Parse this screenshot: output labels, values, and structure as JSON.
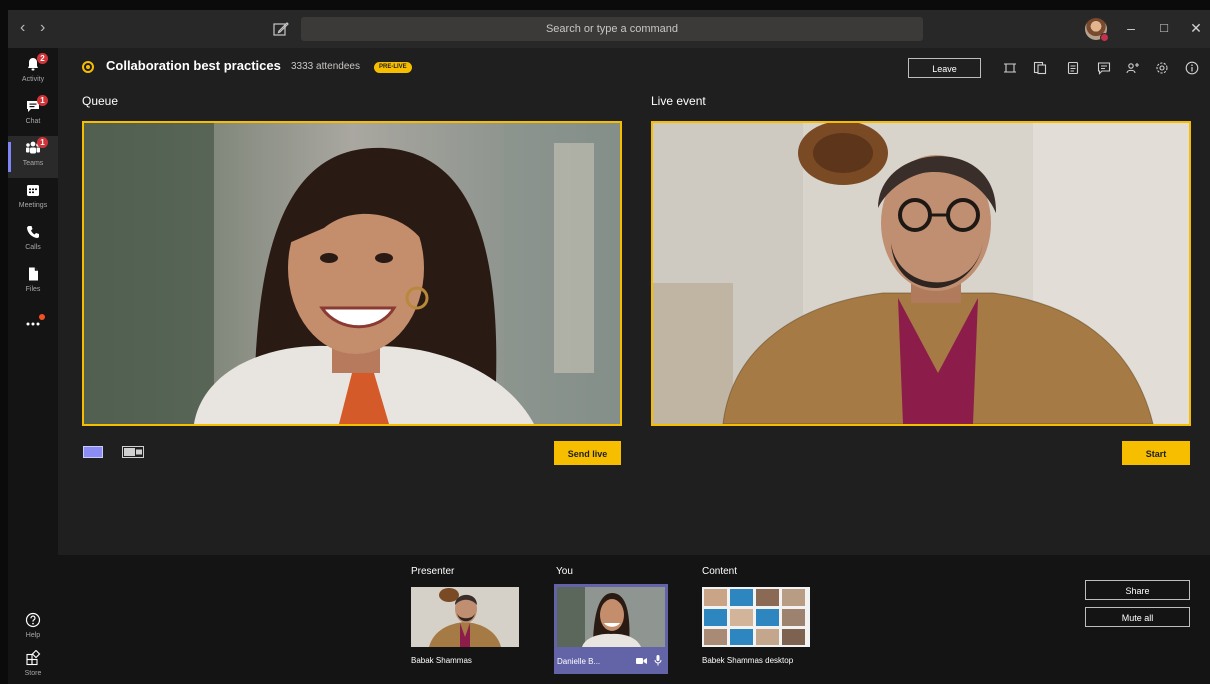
{
  "window": {
    "search_placeholder": "Search or type a command",
    "back_icon": "chevron-left-icon",
    "forward_icon": "chevron-right-icon",
    "compose_icon": "compose-icon",
    "minimize": "–",
    "maximize": "□",
    "close": "✕"
  },
  "rail": {
    "items": [
      {
        "label": "Activity",
        "icon": "bell-icon",
        "badge": "2"
      },
      {
        "label": "Chat",
        "icon": "chat-icon",
        "badge": "1"
      },
      {
        "label": "Teams",
        "icon": "teams-icon",
        "badge": "1",
        "active": true
      },
      {
        "label": "Meetings",
        "icon": "calendar-icon"
      },
      {
        "label": "Calls",
        "icon": "phone-icon"
      },
      {
        "label": "Files",
        "icon": "file-icon"
      },
      {
        "label": "",
        "icon": "more-icon",
        "dot": true
      }
    ],
    "bottom_items": [
      {
        "label": "Help",
        "icon": "help-icon"
      },
      {
        "label": "Store",
        "icon": "store-icon"
      }
    ]
  },
  "event": {
    "title": "Collaboration best practices",
    "attendees": "3333 attendees",
    "status_badge": "PRE-LIVE",
    "leave_label": "Leave"
  },
  "header_icons": [
    "layout-icon",
    "notes-icon",
    "meeting-notes-icon",
    "chat-icon",
    "add-people-icon",
    "settings-icon",
    "info-icon"
  ],
  "queue": {
    "title": "Queue",
    "send_live_label": "Send live"
  },
  "live_event": {
    "title": "Live event",
    "start_label": "Start"
  },
  "bottom": {
    "presenter": {
      "label": "Presenter",
      "name": "Babak Shammas"
    },
    "you": {
      "label": "You",
      "name": "Danielle B..."
    },
    "content": {
      "label": "Content",
      "name": "Babek Shammas desktop"
    },
    "share_label": "Share",
    "mute_all_label": "Mute all"
  },
  "colors": {
    "accent_yellow": "#f7be00",
    "brand_purple": "#6264a7",
    "badge_red": "#d13438"
  }
}
